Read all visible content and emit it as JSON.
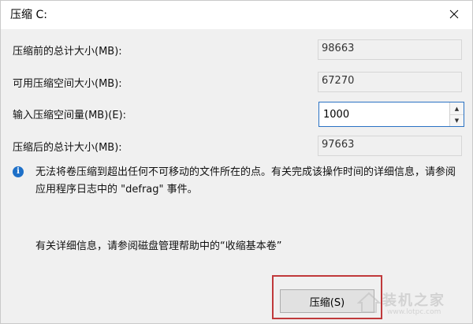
{
  "window": {
    "title": "压缩 C:"
  },
  "fields": [
    {
      "label": "压缩前的总计大小(MB):",
      "value": "98663"
    },
    {
      "label": "可用压缩空间大小(MB):",
      "value": "67270"
    },
    {
      "label": "输入压缩空间量(MB)(E):",
      "value": "1000"
    },
    {
      "label": "压缩后的总计大小(MB):",
      "value": "97663"
    }
  ],
  "info": {
    "text": "无法将卷压缩到超出任何不可移动的文件所在的点。有关完成该操作时间的详细信息，请参阅应用程序日志中的 \"defrag\" 事件。"
  },
  "help": {
    "text": "有关详细信息，请参阅磁盘管理帮助中的“收缩基本卷”"
  },
  "buttons": {
    "compress": "压缩(S)"
  },
  "icons": {
    "close": "close-icon",
    "info": "info-icon",
    "spin_up": "spin-up-icon",
    "spin_down": "spin-down-icon"
  },
  "watermark": {
    "text": "装机之家",
    "url": "www.lotpc.com"
  },
  "colors": {
    "highlight": "#c0393b",
    "info_icon": "#1e70c8",
    "focus_border": "#2a72c4"
  }
}
